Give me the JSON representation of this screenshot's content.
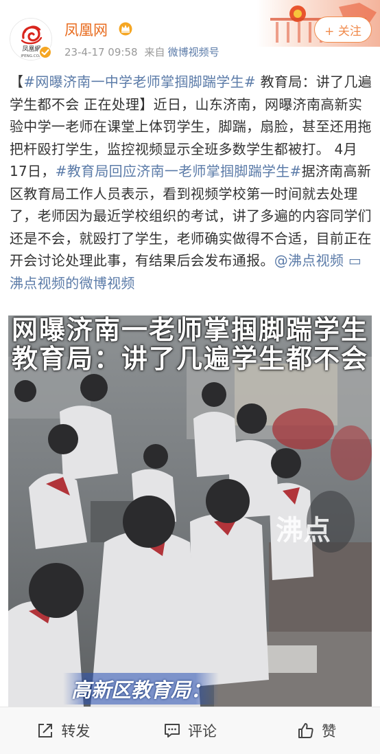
{
  "account": {
    "name": "凤凰网",
    "avatar_logo_text": "凤凰網",
    "avatar_logo_sub": "IFENG.COM",
    "timestamp": "23-4-17 09:58",
    "source_prefix": "来自",
    "source": "微博视频号",
    "follow_label": "+ 关注",
    "verified_icon": "verified-badge-icon",
    "vip_icon": "crown-badge-icon"
  },
  "post": {
    "segments": [
      {
        "text": "【",
        "type": "text"
      },
      {
        "text": "#网曝济南一中学老师掌掴脚踹学生#",
        "type": "link"
      },
      {
        "text": " 教育局：讲了几遍学生都不会 正在处理】近日，山东济南，网曝济南高新实验中学一老师在课堂上体罚学生，脚踹，扇脸，甚至还用拖把杆殴打学生，监控视频显示全班多数学生都被打。 4月17日，",
        "type": "text"
      },
      {
        "text": "#教育局回应济南一老师掌掴脚踹学生#",
        "type": "link"
      },
      {
        "text": "据济南高新区教育局工作人员表示，看到视频学校第一时间就去处理了，老师因为最近学校组织的考试，讲了多遍的内容同学们还是不会，就殴打了学生，老师确实做得不合适，目前正在开会讨论处理此事，有结果后会发布通报。",
        "type": "text"
      },
      {
        "text": "@沸点视频",
        "type": "link"
      },
      {
        "text": " ",
        "type": "text"
      },
      {
        "text": "▭沸点视频的微博视频",
        "type": "link"
      }
    ]
  },
  "video": {
    "caption_line1": "网曝济南一老师掌掴脚踹学生",
    "caption_line2": "教育局：讲了几遍学生都不会",
    "watermark": "沸点",
    "lower_label": "高新区教育局："
  },
  "toolbar": {
    "repost_label": "转发",
    "comment_label": "评论",
    "like_label": "赞"
  },
  "colors": {
    "username": "#e86b1e",
    "link": "#5b7ba8",
    "follow": "#f08a4b",
    "meta": "#999999"
  }
}
